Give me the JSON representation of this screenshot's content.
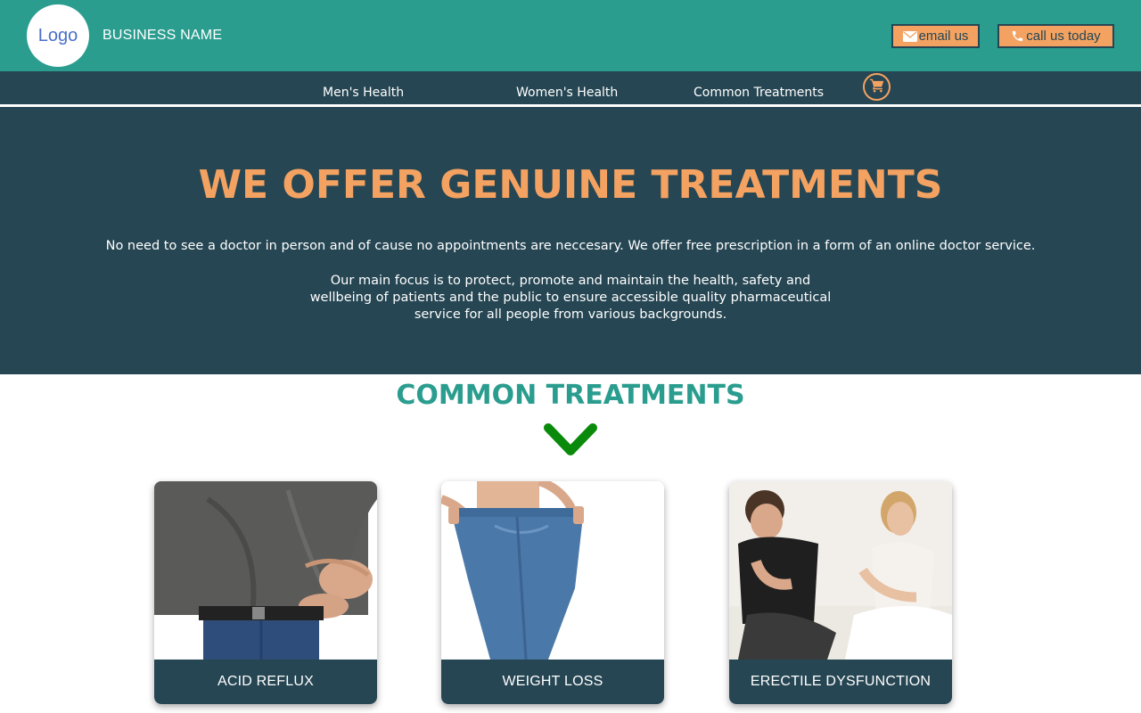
{
  "header": {
    "logo_text": "Logo",
    "business_name": "BUSINESS NAME",
    "email_label": "email us",
    "call_label": "call us today",
    "email_icon": "envelope-icon",
    "call_icon": "phone-icon"
  },
  "nav": {
    "items": [
      {
        "label": "Men's Health"
      },
      {
        "label": "Women's Health"
      },
      {
        "label": "Common Treatments"
      }
    ],
    "cart_icon": "shopping-cart-icon"
  },
  "hero": {
    "title": "WE OFFER GENUINE TREATMENTS",
    "lead": "No need to see a doctor in person and of cause no appointments are neccesary. We offer free prescription in a form of an online doctor service.",
    "focus": "Our main focus is to protect, promote and maintain the health, safety and wellbeing of patients and the public to ensure accessible quality pharmaceutical service for all people from various backgrounds."
  },
  "treatments": {
    "title": "COMMON TREATMENTS",
    "chevron_icon": "chevron-down-icon",
    "cards": [
      {
        "label": "ACID REFLUX"
      },
      {
        "label": "WEIGHT LOSS"
      },
      {
        "label": "ERECTILE DYSFUNCTION"
      }
    ]
  },
  "colors": {
    "header_bg": "#2a9d8f",
    "nav_bg": "#264653",
    "accent": "#f4a261",
    "section_title": "#2a9d8f",
    "chevron": "#0a8a0a"
  }
}
